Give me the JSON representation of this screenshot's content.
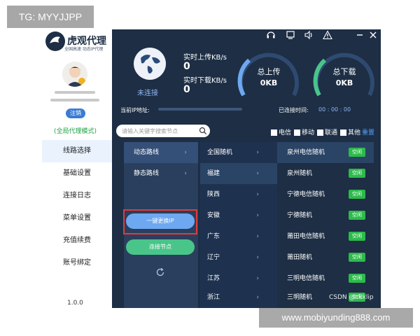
{
  "watermark_top": "TG: MYYJJPP",
  "watermark_bottom": "www.mobiyunding888.com",
  "brand": {
    "name": "虎观代理",
    "tagline": "全国高速 动态IP代理"
  },
  "sidebar": {
    "logout_label": "注销",
    "mode_label": "(全局代理模式)",
    "items": [
      {
        "label": "线路选择"
      },
      {
        "label": "基础设置"
      },
      {
        "label": "连接日志"
      },
      {
        "label": "菜单设置"
      },
      {
        "label": "充值续费"
      },
      {
        "label": "账号绑定"
      }
    ],
    "version": "1.0.0"
  },
  "status": {
    "state": "未连接",
    "upload_speed_label": "实时上传KB/s",
    "upload_speed_value": "0",
    "download_speed_label": "实时下载KB/s",
    "download_speed_value": "0",
    "total_upload_label": "总上传",
    "total_upload_value": "0KB",
    "total_download_label": "总下载",
    "total_download_value": "0KB",
    "current_ip_label": "当前IP地址:",
    "connected_time_label": "已连接时间:",
    "connected_time_value": "00 : 00 : 00"
  },
  "search": {
    "placeholder": "请输入关键字搜索节点"
  },
  "filters": [
    {
      "label": "电信"
    },
    {
      "label": "移动"
    },
    {
      "label": "联通"
    },
    {
      "label": "其他"
    }
  ],
  "reset_label": "重置",
  "route_types": [
    {
      "label": "动态路线"
    },
    {
      "label": "静态路线"
    }
  ],
  "regions": [
    {
      "label": "全国随机"
    },
    {
      "label": "福建"
    },
    {
      "label": "陕西"
    },
    {
      "label": "安徽"
    },
    {
      "label": "广东"
    },
    {
      "label": "辽宁"
    },
    {
      "label": "江苏"
    },
    {
      "label": "浙江"
    }
  ],
  "nodes": [
    {
      "name": "泉州电信随机",
      "status": "空闲"
    },
    {
      "name": "泉州随机",
      "status": "空闲"
    },
    {
      "name": "宁德电信随机",
      "status": "空闲"
    },
    {
      "name": "宁德随机",
      "status": "空闲"
    },
    {
      "name": "莆田电信随机",
      "status": "空闲"
    },
    {
      "name": "莆田随机",
      "status": "空闲"
    },
    {
      "name": "三明电信随机",
      "status": "空闲"
    },
    {
      "name": "三明随机",
      "status": "空闲"
    }
  ],
  "buttons": {
    "switch_ip": "一键更换IP",
    "connect_node": "连接节点"
  },
  "csdn_watermark": "CSDN @ckklip",
  "colors": {
    "app_bg": "#1d2e45",
    "accent_blue": "#6ea8f0",
    "connect_green": "#49c58a",
    "badge_green": "#2cbb4a",
    "highlight_red": "#e13b3b"
  }
}
